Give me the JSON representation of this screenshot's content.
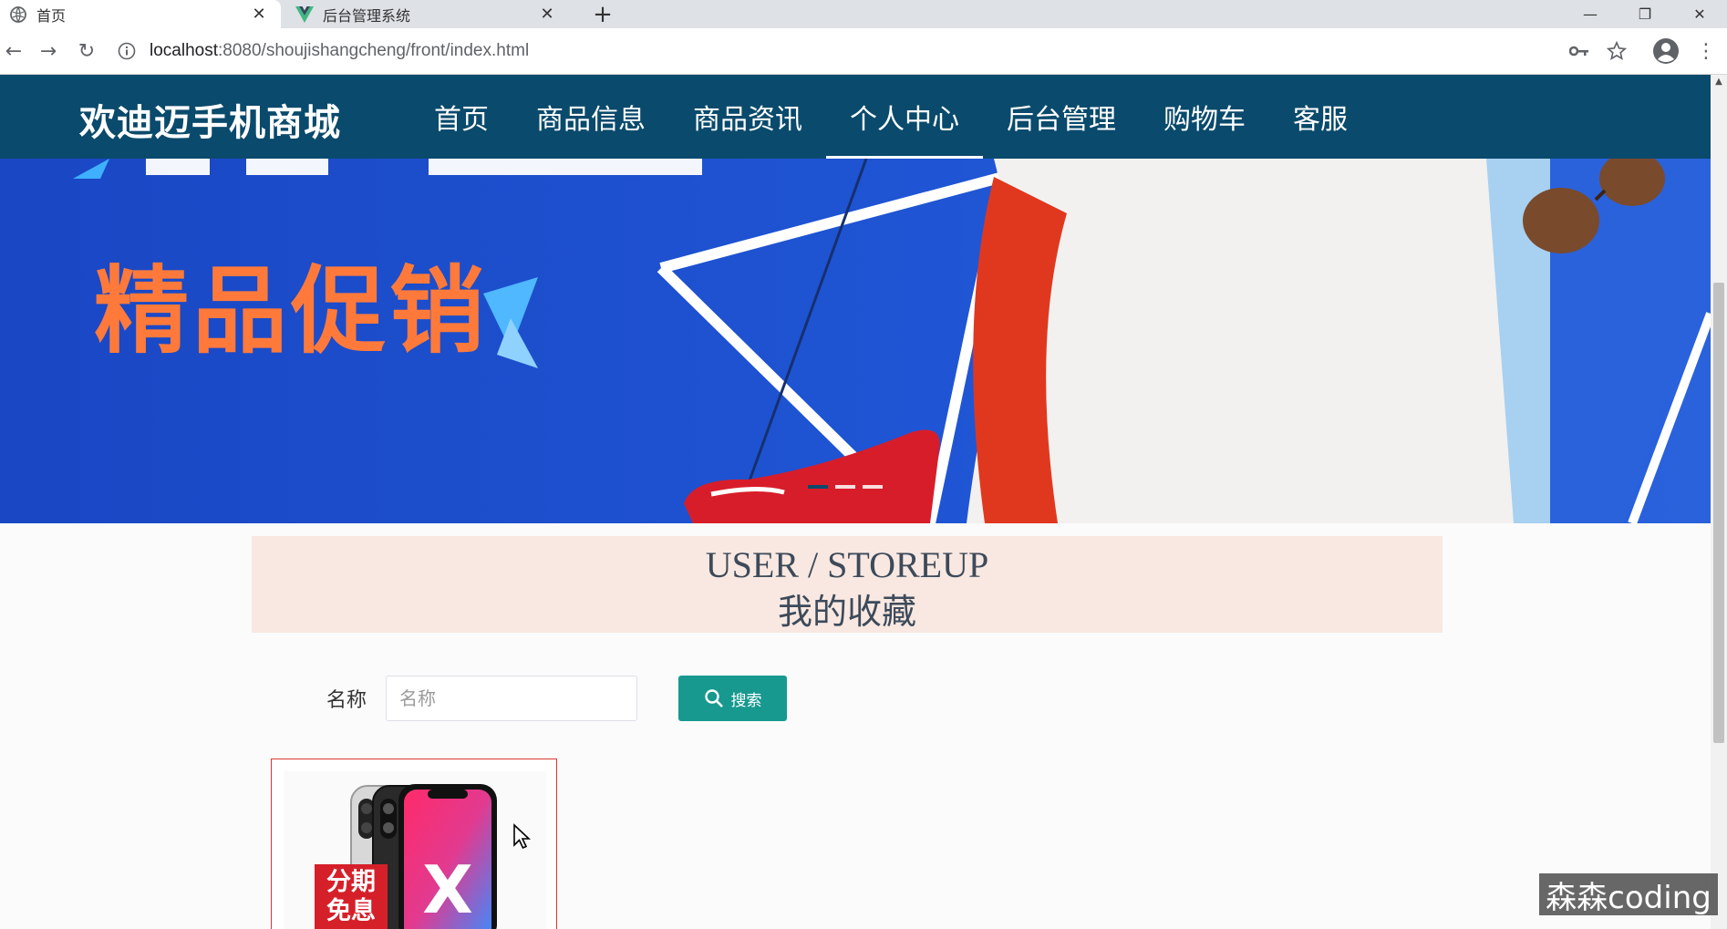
{
  "browser": {
    "tabs": [
      {
        "title": "首页",
        "active": true
      },
      {
        "title": "后台管理系统",
        "active": false
      }
    ],
    "new_tab": "+",
    "url_host": "localhost",
    "url_rest": ":8080/shoujishangcheng/front/index.html"
  },
  "header": {
    "logo": "欢迪迈手机商城",
    "menu": [
      "首页",
      "商品信息",
      "商品资讯",
      "个人中心",
      "后台管理",
      "购物车",
      "客服"
    ],
    "active_menu": "个人中心",
    "bg_color": "#0a4a6c"
  },
  "banner": {
    "promo_text": "精品促销",
    "carousel_dots": 3,
    "active_dot": 1
  },
  "section": {
    "title_en": "USER / STOREUP",
    "title_cn": "我的收藏"
  },
  "search": {
    "label": "名称",
    "placeholder": "名称",
    "value": "",
    "button_label": "搜索",
    "button_color": "#17998f"
  },
  "products": [
    {
      "badge_line1": "分期",
      "badge_line2": "免息",
      "image": "phone-x-image"
    }
  ],
  "watermark": "森森coding"
}
